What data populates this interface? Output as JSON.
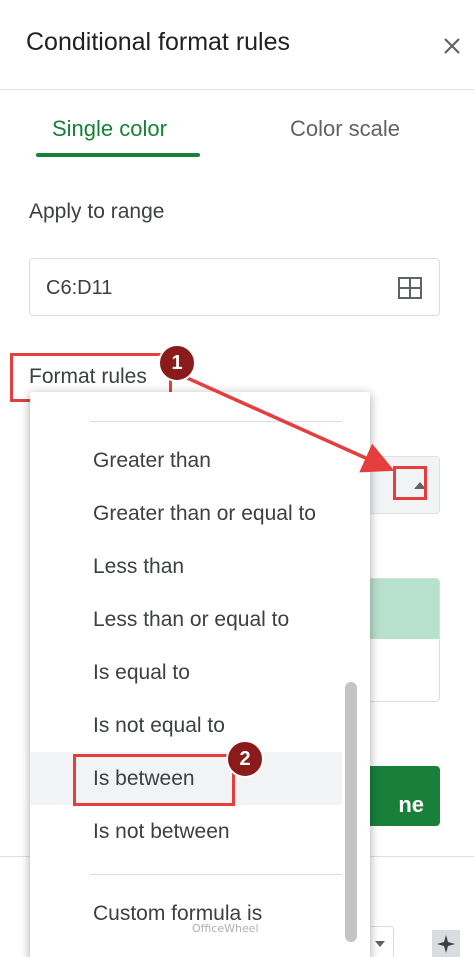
{
  "panel": {
    "title": "Conditional format rules"
  },
  "tabs": [
    {
      "label": "Single color",
      "active": true
    },
    {
      "label": "Color scale",
      "active": false
    }
  ],
  "range": {
    "label": "Apply to range",
    "value": "C6:D11"
  },
  "rules": {
    "label": "Format rules"
  },
  "condition_menu": {
    "items": [
      "Greater than",
      "Greater than or equal to",
      "Less than",
      "Less than or equal to",
      "Is equal to",
      "Is not equal to",
      "Is between",
      "Is not between",
      "Custom formula is"
    ],
    "selected": "Is between"
  },
  "done_label_partial": "ne",
  "annotations": {
    "badge_1": "1",
    "badge_2": "2"
  },
  "watermark": "OfficeWheel",
  "colors": {
    "accent": "#188038",
    "highlight": "#e53e3e",
    "badge": "#8b1a1a",
    "preview_fill": "#b7e1cd"
  },
  "icons": {
    "close": "close-icon",
    "range_select": "grid-icon",
    "dropdown_arrow": "caret-up-icon"
  }
}
